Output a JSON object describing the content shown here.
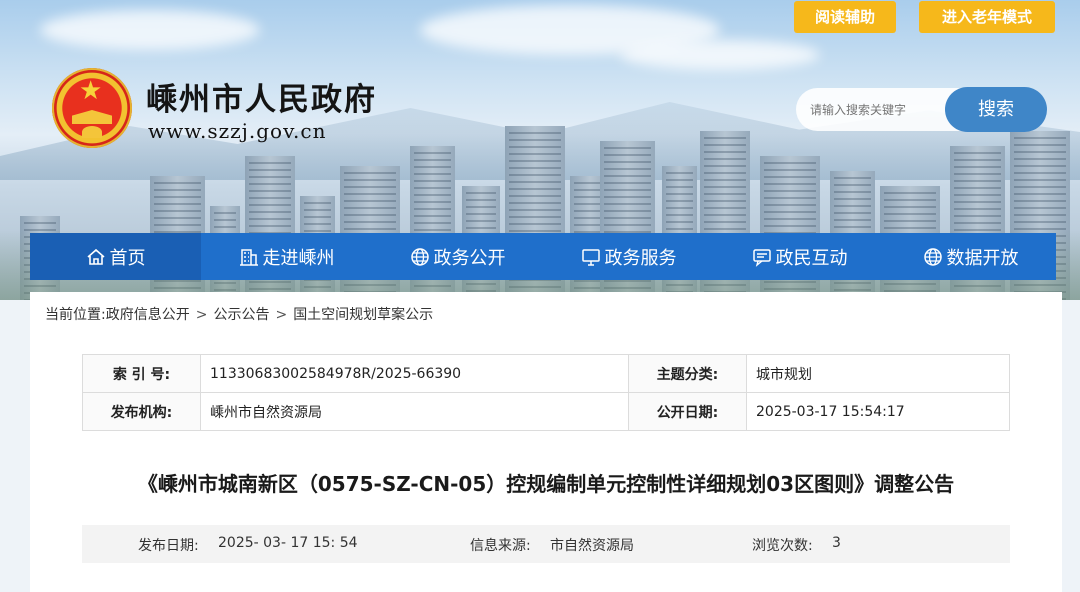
{
  "header": {
    "site_title": "嵊州市人民政府",
    "site_url": "www.szzj.gov.cn",
    "reading_assist": "阅读辅助",
    "elder_mode": "进入老年模式",
    "search": {
      "placeholder": "请输入搜索关键字",
      "button_label": "搜索"
    }
  },
  "nav": {
    "items": [
      {
        "label": "首页",
        "icon": "home-icon"
      },
      {
        "label": "走进嵊州",
        "icon": "building-icon"
      },
      {
        "label": "政务公开",
        "icon": "globe-icon"
      },
      {
        "label": "政务服务",
        "icon": "monitor-icon"
      },
      {
        "label": "政民互动",
        "icon": "chat-icon"
      },
      {
        "label": "数据开放",
        "icon": "globe-icon"
      }
    ]
  },
  "breadcrumb": {
    "prefix": "当前位置:",
    "items": [
      "政府信息公开",
      "公示公告",
      "国土空间规划草案公示"
    ],
    "separator": ">"
  },
  "meta": {
    "index_label": "索 引 号:",
    "index_value": "11330683002584978R/2025-66390",
    "topic_label": "主题分类:",
    "topic_value": "城市规划",
    "publisher_label": "发布机构:",
    "publisher_value": "嵊州市自然资源局",
    "open_date_label": "公开日期:",
    "open_date_value": "2025-03-17 15:54:17"
  },
  "article": {
    "title": "《嵊州市城南新区（0575-SZ-CN-05）控规编制单元控制性详细规划03区图则》调整公告",
    "publish_date_label": "发布日期:",
    "publish_date_value": "2025- 03- 17 15: 54",
    "source_label": "信息来源:",
    "source_value": "市自然资源局",
    "views_label": "浏览次数:",
    "views_value": "3"
  }
}
